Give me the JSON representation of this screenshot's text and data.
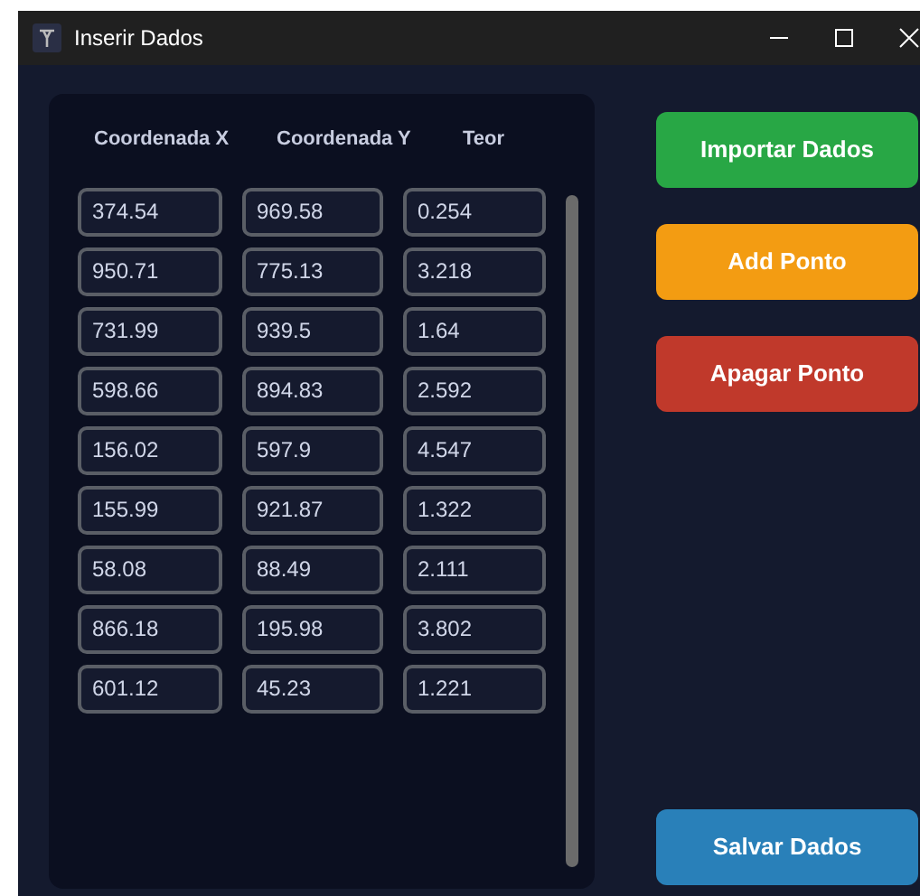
{
  "window": {
    "title": "Inserir Dados"
  },
  "table": {
    "columns": [
      "Coordenada X",
      "Coordenada Y",
      "Teor"
    ],
    "rows": [
      [
        "374.54",
        "969.58",
        "0.254"
      ],
      [
        "950.71",
        "775.13",
        "3.218"
      ],
      [
        "731.99",
        "939.5",
        "1.64"
      ],
      [
        "598.66",
        "894.83",
        "2.592"
      ],
      [
        "156.02",
        "597.9",
        "4.547"
      ],
      [
        "155.99",
        "921.87",
        "1.322"
      ],
      [
        "58.08",
        "88.49",
        "2.111"
      ],
      [
        "866.18",
        "195.98",
        "3.802"
      ],
      [
        "601.12",
        "45.23",
        "1.221"
      ]
    ]
  },
  "buttons": [
    {
      "label": "Importar Dados",
      "color": "#28a745"
    },
    {
      "label": "Add Ponto",
      "color": "#f39c12"
    },
    {
      "label": "Apagar Ponto",
      "color": "#c0392b"
    },
    {
      "label": "Salvar Dados",
      "color": "#2980b9"
    }
  ]
}
